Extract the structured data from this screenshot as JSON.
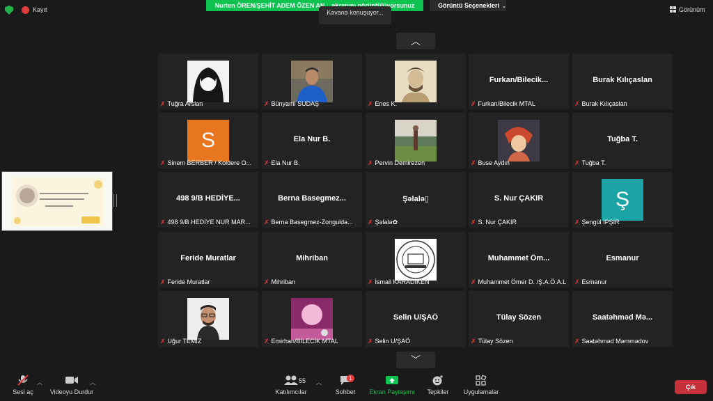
{
  "top": {
    "recording_label": "Kayıt",
    "share_banner": "Nurten ÖREN/ŞEHİT ADEM ÖZEN AN... ekranını görüntülüyorsunuz",
    "view_options_label": "Görüntü Seçenekleri",
    "talking": "Kəvanə konuşuyor...",
    "layout_label": "Görünüm"
  },
  "participants": [
    {
      "name": "Tuğra Arslan",
      "big": "",
      "pic": "anime-avatar"
    },
    {
      "name": "Bünyami SUDAŞ",
      "big": "",
      "pic": "photo"
    },
    {
      "name": "Enes K.",
      "big": "",
      "pic": "sketch"
    },
    {
      "name": "Furkan/Bilecik MTAL",
      "big": "Furkan/Bilecik...",
      "pic": ""
    },
    {
      "name": "Burak Kılıçaslan",
      "big": "Burak Kılıçaslan",
      "pic": ""
    },
    {
      "name": "Sinem BERBER / Koldere O...",
      "big": "",
      "pic": "letter",
      "letter": "S",
      "color": "#e8761e"
    },
    {
      "name": "Ela Nur B.",
      "big": "Ela Nur B.",
      "pic": ""
    },
    {
      "name": "Pervin Demirezen",
      "big": "",
      "pic": "landscape"
    },
    {
      "name": "Buse Aydın",
      "big": "",
      "pic": "cartoon"
    },
    {
      "name": "Tuğba T.",
      "big": "Tuğba T.",
      "pic": ""
    },
    {
      "name": "498 9/B HEDİYE NUR MAR...",
      "big": "498 9/B HEDİYE...",
      "pic": ""
    },
    {
      "name": "Berna Basegmez-Zongulda...",
      "big": "Berna Basegmez...",
      "pic": ""
    },
    {
      "name": "Şəlalə✿",
      "big": "Şəlalə▯",
      "pic": ""
    },
    {
      "name": "S. Nur ÇAKIR",
      "big": "S. Nur ÇAKIR",
      "pic": ""
    },
    {
      "name": "Şengül İPŞİR",
      "big": "",
      "pic": "letter",
      "letter": "Ş",
      "color": "#1ca3a5"
    },
    {
      "name": "Feride Muratlar",
      "big": "Feride Muratlar",
      "pic": ""
    },
    {
      "name": "Mihriban",
      "big": "Mihriban",
      "pic": ""
    },
    {
      "name": "İsmail KARADİKEN",
      "big": "",
      "pic": "emblem"
    },
    {
      "name": "Muhammet Ömer D. /Ş.A.Ö.A.L",
      "big": "Muhammet Öm...",
      "pic": ""
    },
    {
      "name": "Esmanur",
      "big": "Esmanur",
      "pic": ""
    },
    {
      "name": "Uğur TEMİZ",
      "big": "",
      "pic": "portrait"
    },
    {
      "name": "Emirhan/BİLECİK MTAL",
      "big": "",
      "pic": "pink-moon"
    },
    {
      "name": "Selin U/ŞAÖ",
      "big": "Selin U/ŞAÖ",
      "pic": ""
    },
    {
      "name": "Tülay Sözen",
      "big": "Tülay Sözen",
      "pic": ""
    },
    {
      "name": "Saatəhməd Məmmədov",
      "big": "Saatəhməd Mə...",
      "pic": ""
    }
  ],
  "toolbar": {
    "unmute": "Sesi aç",
    "stop_video": "Videoyu Durdur",
    "participants": "Katılımcılar",
    "participants_count": "55",
    "chat": "Sohbet",
    "chat_badge": "1",
    "share": "Ekran Paylaşımı",
    "reactions": "Tepkiler",
    "apps": "Uygulamalar",
    "exit": "Çık"
  },
  "colors": {
    "share_green": "#0ec24f",
    "mic_red": "#e03b3b",
    "exit_red": "#c6303a",
    "tile_bg": "#232323"
  }
}
